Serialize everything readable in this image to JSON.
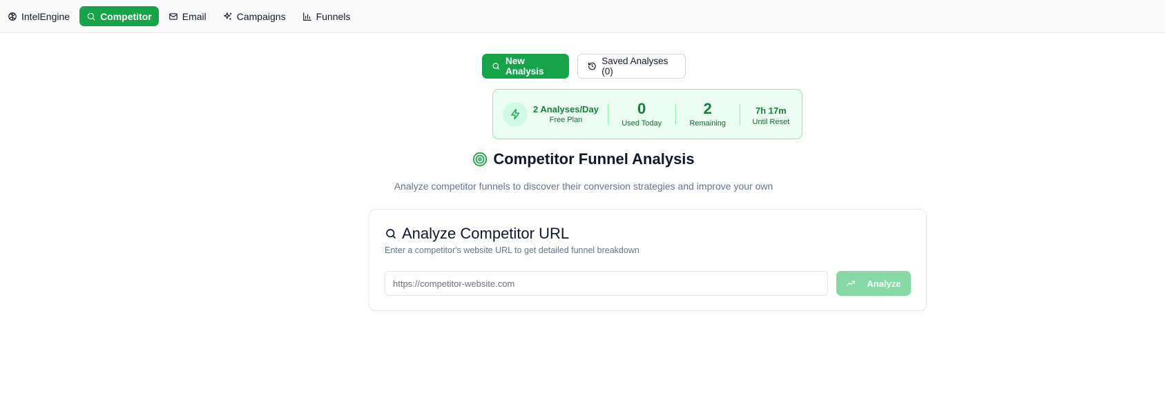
{
  "nav": {
    "brand": "IntelEngine",
    "items": [
      {
        "label": "Competitor",
        "icon": "search-icon",
        "active": true
      },
      {
        "label": "Email",
        "icon": "mail-icon",
        "active": false
      },
      {
        "label": "Campaigns",
        "icon": "sparkles-icon",
        "active": false
      },
      {
        "label": "Funnels",
        "icon": "bar-chart-icon",
        "active": false
      }
    ]
  },
  "modes": {
    "new_analysis": "New Analysis",
    "saved_analyses": "Saved Analyses (0)"
  },
  "usage": {
    "plan_title": "2 Analyses/Day",
    "plan_sub": "Free Plan",
    "used_value": "0",
    "used_label": "Used Today",
    "remaining_value": "2",
    "remaining_label": "Remaining",
    "reset_value": "7h 17m",
    "reset_label": "Until Reset"
  },
  "page": {
    "title": "Competitor Funnel Analysis",
    "subtitle": "Analyze competitor funnels to discover their conversion strategies and improve your own"
  },
  "card": {
    "title": "Analyze Competitor URL",
    "description": "Enter a competitor's website URL to get detailed funnel breakdown",
    "input_placeholder": "https://competitor-website.com",
    "input_value": "",
    "analyze_label": "Analyze"
  },
  "colors": {
    "accent": "#16a34a",
    "accent_light": "#ecfdf3",
    "accent_disabled": "#86d9a5",
    "muted_text": "#64748b"
  }
}
